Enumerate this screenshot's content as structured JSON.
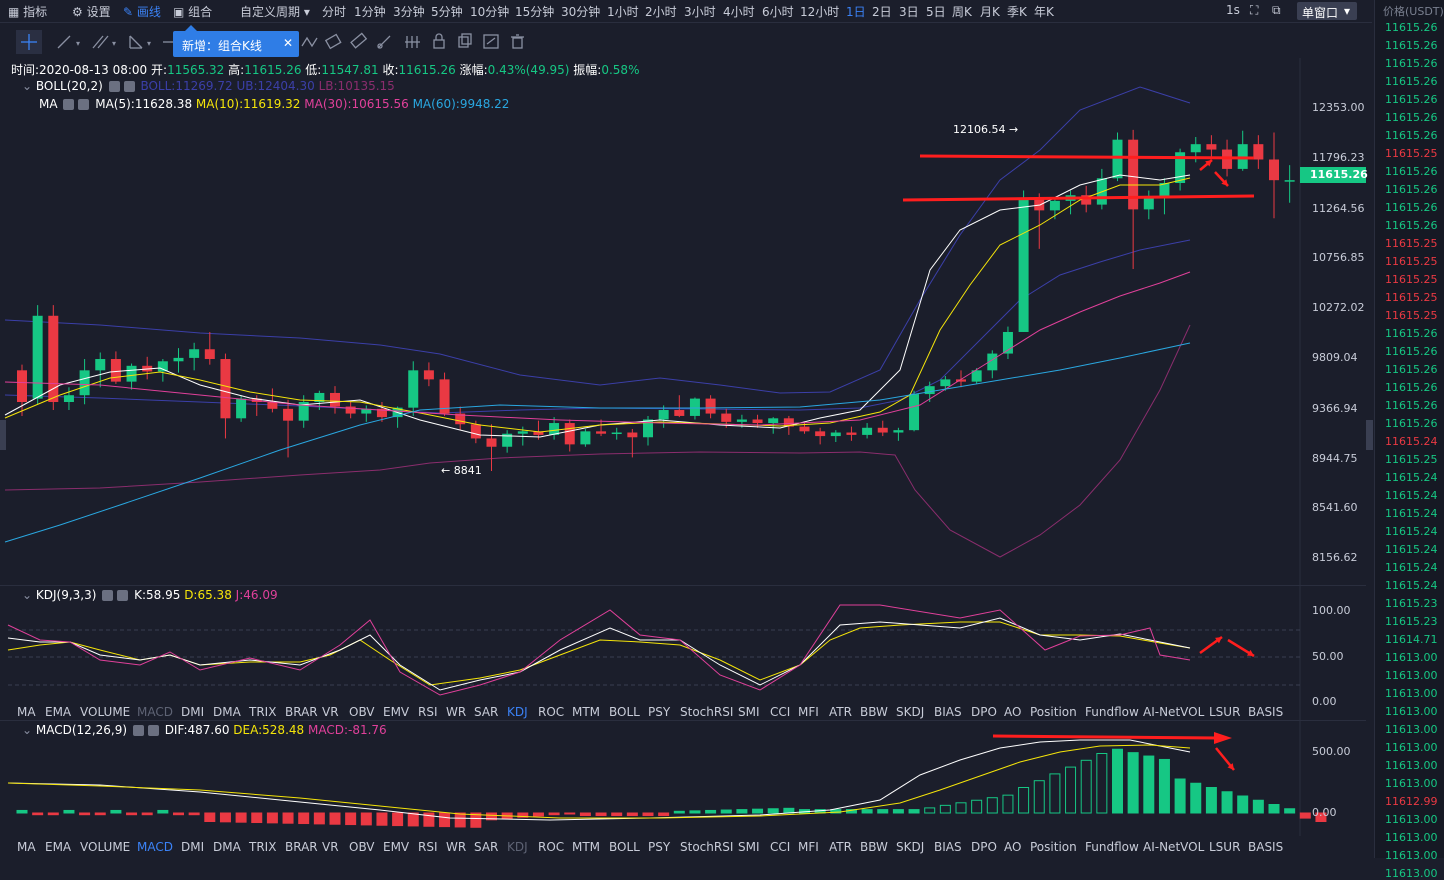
{
  "toolbar": {
    "indicators": "指标",
    "settings": "设置",
    "draw": "画线",
    "combo": "组合",
    "custom_period": "自定义周期",
    "periods": [
      "分时",
      "1分钟",
      "3分钟",
      "5分钟",
      "10分钟",
      "15分钟",
      "30分钟",
      "1小时",
      "2小时",
      "3小时",
      "4小时",
      "6小时",
      "12小时",
      "1日",
      "2日",
      "3日",
      "5日",
      "周K",
      "月K",
      "季K",
      "年K"
    ],
    "active_period": "1日",
    "interval_1s": "1s",
    "window_mode": "单窗口"
  },
  "tooltip": {
    "label": "新增：组合K线",
    "close": "✕"
  },
  "price_header": "价格(USDT)",
  "price_column": [
    {
      "v": "11615.26",
      "c": "g"
    },
    {
      "v": "11615.26",
      "c": "g"
    },
    {
      "v": "11615.26",
      "c": "g"
    },
    {
      "v": "11615.26",
      "c": "g"
    },
    {
      "v": "11615.26",
      "c": "g"
    },
    {
      "v": "11615.26",
      "c": "g"
    },
    {
      "v": "11615.26",
      "c": "g"
    },
    {
      "v": "11615.25",
      "c": "r"
    },
    {
      "v": "11615.26",
      "c": "g"
    },
    {
      "v": "11615.26",
      "c": "g"
    },
    {
      "v": "11615.26",
      "c": "g"
    },
    {
      "v": "11615.26",
      "c": "g"
    },
    {
      "v": "11615.25",
      "c": "r"
    },
    {
      "v": "11615.25",
      "c": "r"
    },
    {
      "v": "11615.25",
      "c": "r"
    },
    {
      "v": "11615.25",
      "c": "r"
    },
    {
      "v": "11615.25",
      "c": "r"
    },
    {
      "v": "11615.26",
      "c": "g"
    },
    {
      "v": "11615.26",
      "c": "g"
    },
    {
      "v": "11615.26",
      "c": "g"
    },
    {
      "v": "11615.26",
      "c": "g"
    },
    {
      "v": "11615.26",
      "c": "g"
    },
    {
      "v": "11615.26",
      "c": "g"
    },
    {
      "v": "11615.24",
      "c": "r"
    },
    {
      "v": "11615.25",
      "c": "g"
    },
    {
      "v": "11615.24",
      "c": "g"
    },
    {
      "v": "11615.24",
      "c": "g"
    },
    {
      "v": "11615.24",
      "c": "g"
    },
    {
      "v": "11615.24",
      "c": "g"
    },
    {
      "v": "11615.24",
      "c": "g"
    },
    {
      "v": "11615.24",
      "c": "g"
    },
    {
      "v": "11615.24",
      "c": "g"
    },
    {
      "v": "11615.23",
      "c": "g"
    },
    {
      "v": "11615.23",
      "c": "g"
    },
    {
      "v": "11614.71",
      "c": "g"
    },
    {
      "v": "11613.00",
      "c": "g"
    },
    {
      "v": "11613.00",
      "c": "g"
    },
    {
      "v": "11613.00",
      "c": "g"
    },
    {
      "v": "11613.00",
      "c": "g"
    },
    {
      "v": "11613.00",
      "c": "g"
    },
    {
      "v": "11613.00",
      "c": "g"
    },
    {
      "v": "11613.00",
      "c": "g"
    },
    {
      "v": "11613.00",
      "c": "g"
    },
    {
      "v": "11612.99",
      "c": "r"
    },
    {
      "v": "11613.00",
      "c": "g"
    },
    {
      "v": "11613.00",
      "c": "g"
    },
    {
      "v": "11613.00",
      "c": "g"
    },
    {
      "v": "11613.00",
      "c": "g"
    }
  ],
  "ohlc": {
    "time_label": "时间:",
    "time": "2020-08-13 08:00",
    "open_label": "开:",
    "open": "11565.32",
    "high_label": "高:",
    "high": "11615.26",
    "low_label": "低:",
    "low": "11547.81",
    "close_label": "收:",
    "close": "11615.26",
    "change_label": "涨幅:",
    "change": "0.43%(49.95)",
    "amp_label": "振幅:",
    "amp": "0.58%"
  },
  "boll": {
    "name": "BOLL(20,2)",
    "boll": "BOLL:11269.72",
    "ub": "UB:12404.30",
    "lb": "LB:10135.15"
  },
  "ma": {
    "name": "MA",
    "ma5": "MA(5):11628.38",
    "ma10": "MA(10):11619.32",
    "ma30": "MA(30):10615.56",
    "ma60": "MA(60):9948.22"
  },
  "price_axis": [
    "12353.00",
    "11796.23",
    "11264.56",
    "10756.85",
    "10272.02",
    "9809.04",
    "9366.94",
    "8944.75",
    "8541.60",
    "8156.62"
  ],
  "last_price": "11615.26",
  "annotations": {
    "high": "12106.54",
    "low": "8841"
  },
  "kdj": {
    "name": "KDJ(9,3,3)",
    "k": "K:58.95",
    "d": "D:65.38",
    "j": "J:46.09",
    "axis": [
      "100.00",
      "50.00",
      "0.00"
    ]
  },
  "macd": {
    "name": "MACD(12,26,9)",
    "dif": "DIF:487.60",
    "dea": "DEA:528.48",
    "macd": "MACD:-81.76",
    "axis": [
      "500.00",
      "0.00"
    ]
  },
  "indicator_tabs": [
    "MA",
    "EMA",
    "VOLUME",
    "MACD",
    "DMI",
    "DMA",
    "TRIX",
    "BRAR",
    "VR",
    "OBV",
    "EMV",
    "RSI",
    "WR",
    "SAR",
    "KDJ",
    "ROC",
    "MTM",
    "BOLL",
    "PSY",
    "StochRSI",
    "SMI",
    "CCI",
    "MFI",
    "ATR",
    "BBW",
    "SKDJ",
    "BIAS",
    "DPO",
    "AO",
    "Position",
    "Fundflow",
    "AI-NetVOL",
    "LSUR",
    "BASIS"
  ],
  "colors": {
    "up": "#16c784",
    "down": "#ea3943",
    "accent": "#3b82f6",
    "ma5": "#ffffff",
    "ma10": "#f5e50a",
    "ma30": "#e0409a",
    "ma60": "#2aa7e0",
    "boll": "#3b3fa8"
  }
}
